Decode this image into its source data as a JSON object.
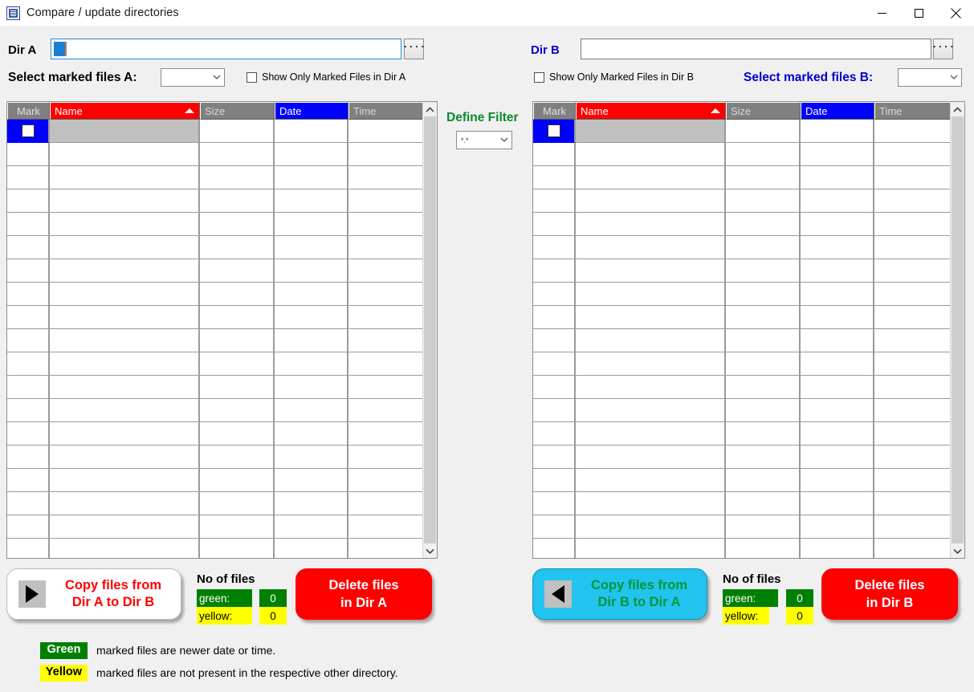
{
  "window": {
    "title": "Compare / update directories",
    "icon": "app-window-icon",
    "controls": {
      "minimize": "minimize-icon",
      "maximize": "maximize-icon",
      "close": "close-icon"
    }
  },
  "dirA": {
    "label": "Dir A",
    "value": "",
    "browse_label": "....",
    "select_marked_label": "Select marked files A:",
    "select_marked_value": "",
    "show_only_marked_label": "Show Only Marked Files in Dir A",
    "show_only_marked_checked": false
  },
  "dirB": {
    "label": "Dir B",
    "value": "",
    "browse_label": "....",
    "select_marked_label": "Select marked files B:",
    "select_marked_value": "",
    "show_only_marked_label": "Show Only Marked Files in Dir B",
    "show_only_marked_checked": false
  },
  "filter": {
    "title": "Define Filter",
    "value": "*.*"
  },
  "table": {
    "columns": [
      "Mark",
      "Name",
      "Size",
      "Date",
      "Time"
    ],
    "sorted_column": "Name",
    "sort_direction": "ascending",
    "rows": []
  },
  "actions": {
    "copy_a_to_b": "Copy files from\nDir A to Dir B",
    "copy_a_to_b_line1": "Copy files from",
    "copy_a_to_b_line2": "Dir A to Dir B",
    "copy_b_to_a_line1": "Copy files from",
    "copy_b_to_a_line2": "Dir B to Dir A",
    "delete_a_line1": "Delete files",
    "delete_a_line2": "in Dir A",
    "delete_b_line1": "Delete files",
    "delete_b_line2": "in Dir B",
    "arrow_right": "play-right-icon",
    "arrow_left": "play-left-icon"
  },
  "countsA": {
    "title": "No of files",
    "green_label": "green:",
    "green_value": "0",
    "yellow_label": "yellow:",
    "yellow_value": "0"
  },
  "countsB": {
    "title": "No of files",
    "green_label": "green:",
    "green_value": "0",
    "yellow_label": "yellow:",
    "yellow_value": "0"
  },
  "legend": {
    "green_chip": "Green",
    "green_text": "marked files are newer date or time.",
    "yellow_chip": "Yellow",
    "yellow_text": "marked files are not present in the respective other directory."
  },
  "colors": {
    "header_name": "#ff0000",
    "header_date": "#0000ff",
    "header_default": "#808080",
    "accent_blue": "#0000d0",
    "filter_green": "#0a8a2a",
    "copy_b_bg": "#23c3ef",
    "delete_bg": "#ff0000",
    "green_status": "#008000",
    "yellow_status": "#ffff00"
  }
}
